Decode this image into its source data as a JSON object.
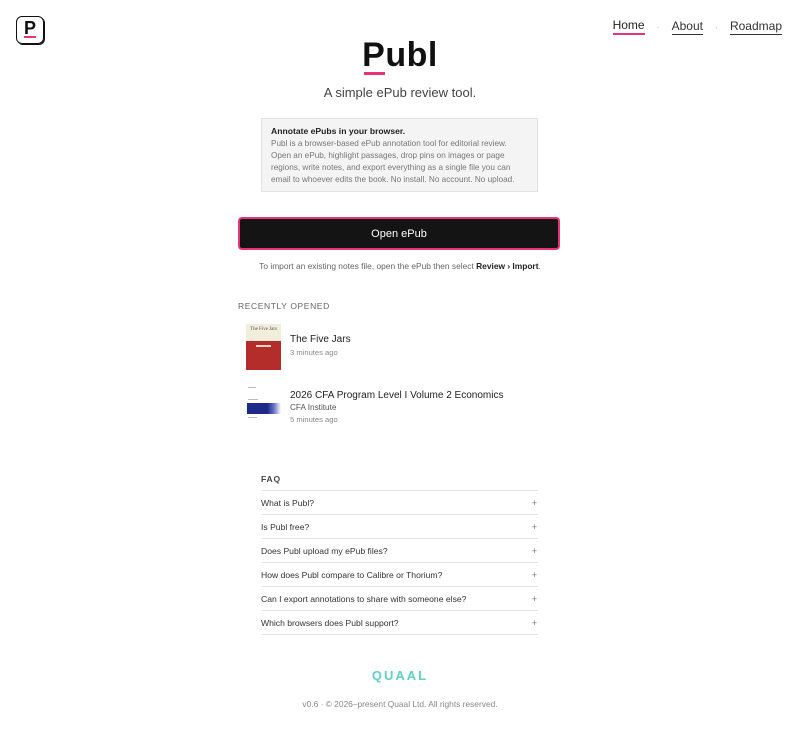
{
  "logo": {
    "letter": "P"
  },
  "nav": {
    "items": [
      {
        "label": "Home",
        "active": true
      },
      {
        "label": "About",
        "active": false
      },
      {
        "label": "Roadmap",
        "active": false
      }
    ],
    "separator": "·"
  },
  "hero": {
    "title": "Publ",
    "subtitle": "A simple ePub review tool."
  },
  "intro": {
    "heading": "Annotate ePubs in your browser.",
    "body": "Publ is a browser-based ePub annotation tool for editorial review. Open an ePub, highlight passages, drop pins on images or page regions, write notes, and export everything as a single file you can email to whoever edits the book. No install. No account. No upload."
  },
  "open_button": {
    "label": "Open ePub"
  },
  "import_hint": {
    "prefix": "To import an existing notes file, open the ePub then select ",
    "path": "Review › Import",
    "suffix": "."
  },
  "recent": {
    "heading": "RECENTLY OPENED",
    "books": [
      {
        "title": "The Five Jars",
        "author": "",
        "time": "3 minutes ago",
        "cover_text": "The Five Jars"
      },
      {
        "title": "2026 CFA Program Level I Volume 2 Economics",
        "author": "CFA Institute",
        "time": "5 minutes ago"
      }
    ]
  },
  "faq": {
    "heading": "FAQ",
    "items": [
      "What is Publ?",
      "Is Publ free?",
      "Does Publ upload my ePub files?",
      "How does Publ compare to Calibre or Thorium?",
      "Can I export annotations to share with someone else?",
      "Which browsers does Publ support?"
    ],
    "expand_glyph": "+"
  },
  "brand": {
    "name": "QUAAL"
  },
  "footer": {
    "text": "v0.6 · © 2026–present Quaal Ltd. All rights reserved."
  },
  "colors": {
    "accent": "#e6337a",
    "brand": "#5fd0c7",
    "button_bg": "#141414"
  }
}
